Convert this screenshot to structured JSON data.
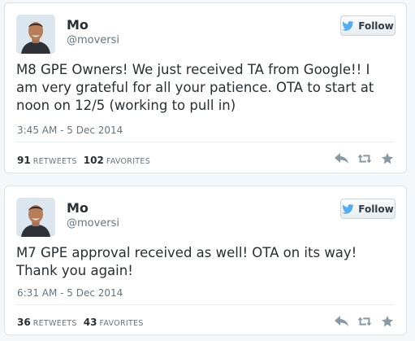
{
  "colors": {
    "text": "#292f33",
    "muted": "#66757f",
    "twitter_blue": "#55acee",
    "action_gray": "#8899a6"
  },
  "tweets": [
    {
      "name": "Mo",
      "handle": "@moversi",
      "follow_label": "Follow",
      "text": "M8 GPE Owners! We just received TA from Google!! I am very grateful for all your patience. OTA to start at noon on 12/5 (working to pull in)",
      "timestamp": "3:45 AM - 5 Dec 2014",
      "retweets_count": "91",
      "retweets_label": "RETWEETS",
      "favorites_count": "102",
      "favorites_label": "FAVORITES",
      "icons": [
        "twitter-bird-icon",
        "reply-icon",
        "retweet-icon",
        "favorite-star-icon"
      ]
    },
    {
      "name": "Mo",
      "handle": "@moversi",
      "follow_label": "Follow",
      "text": "M7 GPE approval received as well! OTA on its way! Thank you again!",
      "timestamp": "6:31 AM - 5 Dec 2014",
      "retweets_count": "36",
      "retweets_label": "RETWEETS",
      "favorites_count": "43",
      "favorites_label": "FAVORITES",
      "icons": [
        "twitter-bird-icon",
        "reply-icon",
        "retweet-icon",
        "favorite-star-icon"
      ]
    }
  ]
}
